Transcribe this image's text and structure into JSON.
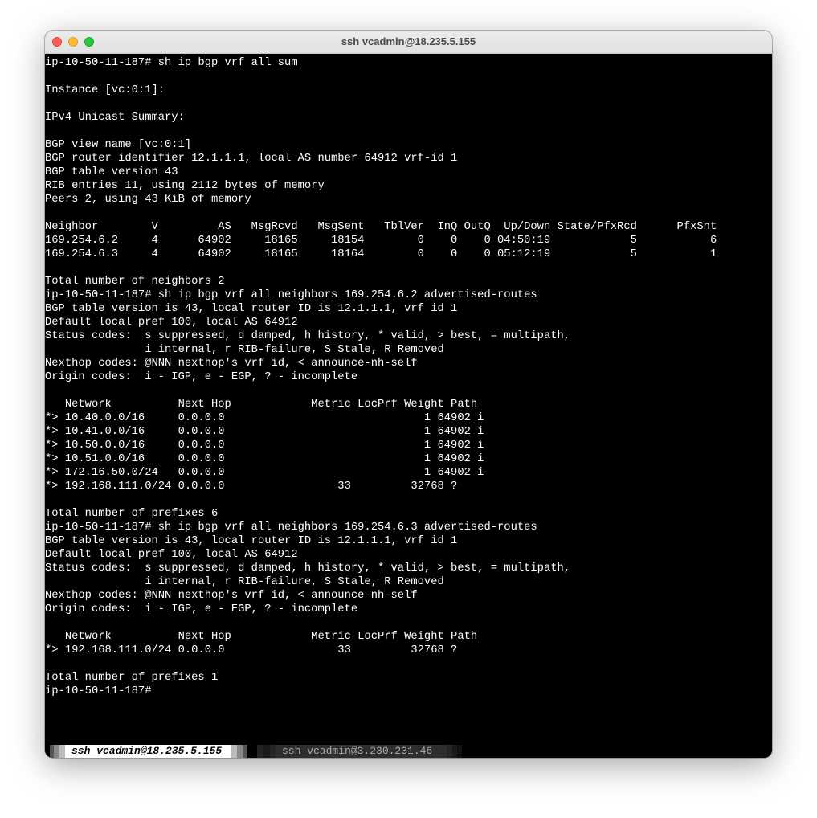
{
  "window": {
    "title": "ssh vcadmin@18.235.5.155"
  },
  "terminal": {
    "lines": [
      "ip-10-50-11-187# sh ip bgp vrf all sum",
      "",
      "Instance [vc:0:1]:",
      "",
      "IPv4 Unicast Summary:",
      "",
      "BGP view name [vc:0:1]",
      "BGP router identifier 12.1.1.1, local AS number 64912 vrf-id 1",
      "BGP table version 43",
      "RIB entries 11, using 2112 bytes of memory",
      "Peers 2, using 43 KiB of memory",
      "",
      "Neighbor        V         AS   MsgRcvd   MsgSent   TblVer  InQ OutQ  Up/Down State/PfxRcd      PfxSnt",
      "169.254.6.2     4      64902     18165     18154        0    0    0 04:50:19            5           6",
      "169.254.6.3     4      64902     18165     18164        0    0    0 05:12:19            5           1",
      "",
      "Total number of neighbors 2",
      "ip-10-50-11-187# sh ip bgp vrf all neighbors 169.254.6.2 advertised-routes",
      "BGP table version is 43, local router ID is 12.1.1.1, vrf id 1",
      "Default local pref 100, local AS 64912",
      "Status codes:  s suppressed, d damped, h history, * valid, > best, = multipath,",
      "               i internal, r RIB-failure, S Stale, R Removed",
      "Nexthop codes: @NNN nexthop's vrf id, < announce-nh-self",
      "Origin codes:  i - IGP, e - EGP, ? - incomplete",
      "",
      "   Network          Next Hop            Metric LocPrf Weight Path",
      "*> 10.40.0.0/16     0.0.0.0                              1 64902 i",
      "*> 10.41.0.0/16     0.0.0.0                              1 64902 i",
      "*> 10.50.0.0/16     0.0.0.0                              1 64902 i",
      "*> 10.51.0.0/16     0.0.0.0                              1 64902 i",
      "*> 172.16.50.0/24   0.0.0.0                              1 64902 i",
      "*> 192.168.111.0/24 0.0.0.0                 33         32768 ?",
      "",
      "Total number of prefixes 6",
      "ip-10-50-11-187# sh ip bgp vrf all neighbors 169.254.6.3 advertised-routes",
      "BGP table version is 43, local router ID is 12.1.1.1, vrf id 1",
      "Default local pref 100, local AS 64912",
      "Status codes:  s suppressed, d damped, h history, * valid, > best, = multipath,",
      "               i internal, r RIB-failure, S Stale, R Removed",
      "Nexthop codes: @NNN nexthop's vrf id, < announce-nh-self",
      "Origin codes:  i - IGP, e - EGP, ? - incomplete",
      "",
      "   Network          Next Hop            Metric LocPrf Weight Path",
      "*> 192.168.111.0/24 0.0.0.0                 33         32768 ?",
      "",
      "Total number of prefixes 1",
      "ip-10-50-11-187#"
    ]
  },
  "statusbar": {
    "active_tab": "ssh vcadmin@18.235.5.155",
    "inactive_tab": "ssh vcadmin@3.230.231.46"
  }
}
